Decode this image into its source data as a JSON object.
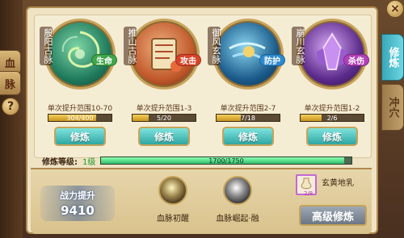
{
  "left_tabs": [
    {
      "label": "血"
    },
    {
      "label": "脉"
    }
  ],
  "help_label": "?",
  "close_label": "×",
  "right_tabs": [
    {
      "label": "修炼",
      "active": true
    },
    {
      "label": "冲穴",
      "active": false
    }
  ],
  "cards": [
    {
      "name": "殷阳古脉",
      "tag": "生命",
      "tag_color": "#3fa64a",
      "range": "单次提升范围10-70",
      "progress_text": "304/400",
      "progress": 0.76,
      "button": "修炼",
      "orb_color": "#1f7a5c"
    },
    {
      "name": "推山古脉",
      "tag": "攻击",
      "tag_color": "#d8442a",
      "range": "单次提升范围1-3",
      "progress_text": "5/20",
      "progress": 0.25,
      "button": "修炼",
      "orb_color": "#c0582a"
    },
    {
      "name": "御风玄脉",
      "tag": "防护",
      "tag_color": "#2e8ad0",
      "range": "单次提升范围2-7",
      "progress_text": "7/18",
      "progress": 0.39,
      "button": "修炼",
      "orb_color": "#1a5a8a"
    },
    {
      "name": "崩川玄脉",
      "tag": "杀伤",
      "tag_color": "#b040b8",
      "range": "单次提升范围1-2",
      "progress_text": "2/6",
      "progress": 0.33,
      "button": "修炼",
      "orb_color": "#5a2a8a"
    }
  ],
  "level": {
    "label": "修炼等级:",
    "value": "1级",
    "text": "1700/1750",
    "progress": 0.97
  },
  "power": {
    "label": "战力提升",
    "value": "9410"
  },
  "skills": [
    {
      "label": "血脉初醒"
    },
    {
      "label": "血脉崛起·融"
    }
  ],
  "item": {
    "name": "玄黄地乳",
    "count": "2/8"
  },
  "advanced_button": "高级修炼"
}
